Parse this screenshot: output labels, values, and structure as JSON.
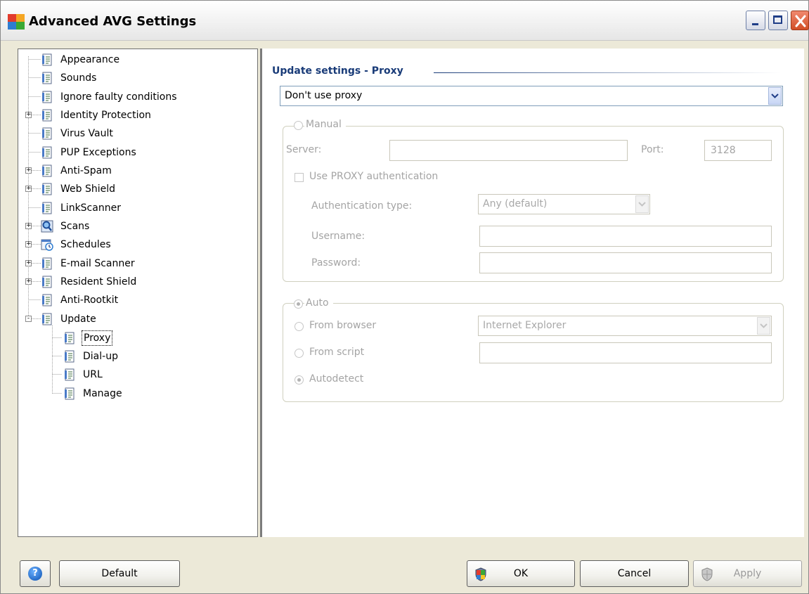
{
  "window": {
    "title": "Advanced AVG Settings",
    "controls": {
      "minimize": "minimize",
      "maximize": "maximize",
      "close": "close"
    }
  },
  "tree": {
    "items": [
      {
        "label": "Appearance",
        "icon": "settings-page-icon",
        "expander": null
      },
      {
        "label": "Sounds",
        "icon": "settings-page-icon",
        "expander": null
      },
      {
        "label": "Ignore faulty conditions",
        "icon": "settings-page-icon",
        "expander": null
      },
      {
        "label": "Identity Protection",
        "icon": "settings-page-icon",
        "expander": "+"
      },
      {
        "label": "Virus Vault",
        "icon": "settings-page-icon",
        "expander": null
      },
      {
        "label": "PUP Exceptions",
        "icon": "settings-page-icon",
        "expander": null
      },
      {
        "label": "Anti-Spam",
        "icon": "settings-page-icon",
        "expander": "+"
      },
      {
        "label": "Web Shield",
        "icon": "settings-page-icon",
        "expander": "+"
      },
      {
        "label": "LinkScanner",
        "icon": "settings-page-icon",
        "expander": null
      },
      {
        "label": "Scans",
        "icon": "magnifier-icon",
        "expander": "+"
      },
      {
        "label": "Schedules",
        "icon": "schedule-icon",
        "expander": "+"
      },
      {
        "label": "E-mail Scanner",
        "icon": "settings-page-icon",
        "expander": "+"
      },
      {
        "label": "Resident Shield",
        "icon": "settings-page-icon",
        "expander": "+"
      },
      {
        "label": "Anti-Rootkit",
        "icon": "settings-page-icon",
        "expander": null
      },
      {
        "label": "Update",
        "icon": "settings-page-icon",
        "expander": "-"
      },
      {
        "label": "Proxy",
        "icon": "settings-page-icon",
        "expander": null,
        "selected": true
      },
      {
        "label": "Dial-up",
        "icon": "settings-page-icon",
        "expander": null
      },
      {
        "label": "URL",
        "icon": "settings-page-icon",
        "expander": null
      },
      {
        "label": "Manage",
        "icon": "settings-page-icon",
        "expander": null
      }
    ]
  },
  "panel": {
    "title": "Update settings - Proxy",
    "proxy_mode": {
      "selected": "Don't use proxy"
    },
    "manual": {
      "label": "Manual",
      "selected": false,
      "server_label": "Server:",
      "server_value": "",
      "port_label": "Port:",
      "port_value": "3128",
      "use_auth_label": "Use PROXY authentication",
      "use_auth_checked": false,
      "auth_type_label": "Authentication type:",
      "auth_type_value": "Any (default)",
      "username_label": "Username:",
      "username_value": "",
      "password_label": "Password:",
      "password_value": ""
    },
    "auto": {
      "label": "Auto",
      "selected": true,
      "from_browser_label": "From browser",
      "browser_value": "Internet Explorer",
      "from_script_label": "From script",
      "script_value": "",
      "autodetect_label": "Autodetect",
      "autodetect_selected": true
    }
  },
  "footer": {
    "help_glyph": "?",
    "default_label": "Default",
    "ok_label": "OK",
    "cancel_label": "Cancel",
    "apply_label": "Apply"
  },
  "colors": {
    "section_title": "#193b78",
    "disabled_text": "#a4a4a4",
    "dialog_face": "#ece9d8"
  }
}
